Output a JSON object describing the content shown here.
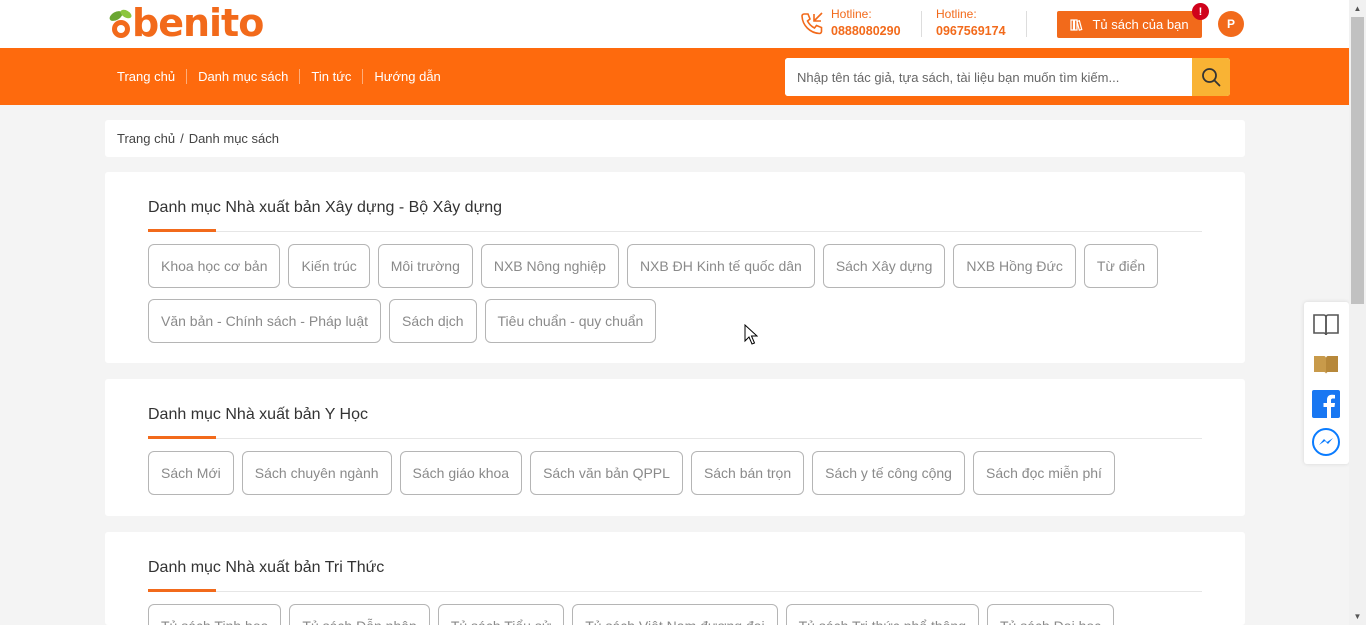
{
  "header": {
    "logo_text": "benito",
    "hotline1": {
      "label": "Hotline:",
      "number": "0888080290"
    },
    "hotline2": {
      "label": "Hotline:",
      "number": "0967569174"
    },
    "shelf_button": "Tủ sách của bạn",
    "notification_badge": "!",
    "avatar_letter": "P"
  },
  "nav": {
    "items": [
      "Trang chủ",
      "Danh mục sách",
      "Tin tức",
      "Hướng dẫn"
    ],
    "search_placeholder": "Nhập tên tác giả, tựa sách, tài liệu bạn muốn tìm kiếm..."
  },
  "breadcrumb": {
    "home": "Trang chủ",
    "separator": "/",
    "current": "Danh mục sách"
  },
  "sections": [
    {
      "title": "Danh mục Nhà xuất bản Xây dựng - Bộ Xây dựng",
      "tags": [
        "Khoa học cơ bản",
        "Kiến trúc",
        "Môi trường",
        "NXB Nông nghiệp",
        "NXB ĐH Kinh tế quốc dân",
        "Sách Xây dựng",
        "NXB Hồng Đức",
        "Từ điển",
        "Văn bản - Chính sách - Pháp luật",
        "Sách dịch",
        "Tiêu chuẩn - quy chuẩn"
      ]
    },
    {
      "title": "Danh mục Nhà xuất bản Y Học",
      "tags": [
        "Sách Mới",
        "Sách chuyên ngành",
        "Sách giáo khoa",
        "Sách văn bản QPPL",
        "Sách bán trọn",
        "Sách y tế công cộng",
        "Sách đọc miễn phí"
      ]
    },
    {
      "title": "Danh mục Nhà xuất bản Tri Thức",
      "tags": [
        "Tủ sách Tinh hoa",
        "Tủ sách Dẫn nhập",
        "Tủ sách Tiểu sử",
        "Tủ sách Việt Nam đương đại",
        "Tủ sách Tri thức phổ thông",
        "Tủ sách Đại học"
      ]
    }
  ],
  "colors": {
    "brand_orange": "#fe6a0d",
    "search_button": "#f9b334",
    "badge_red": "#d0021b"
  },
  "float_icons": [
    "open-book-icon",
    "closed-book-icon",
    "facebook-icon",
    "messenger-icon"
  ]
}
